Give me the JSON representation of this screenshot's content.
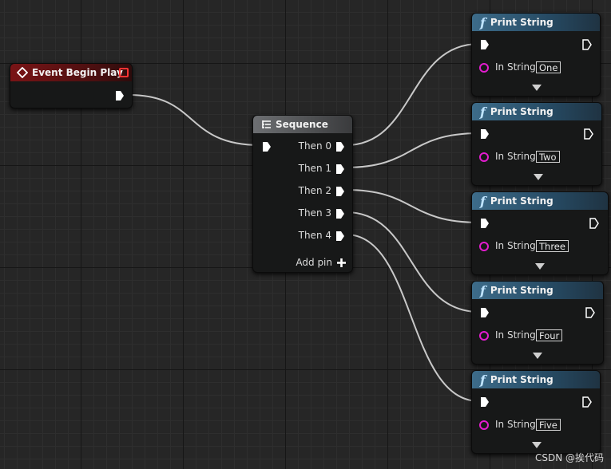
{
  "event_node": {
    "title": "Event Begin Play"
  },
  "sequence_node": {
    "title": "Sequence",
    "outputs": [
      "Then 0",
      "Then 1",
      "Then 2",
      "Then 3",
      "Then 4"
    ],
    "add_pin": "Add pin"
  },
  "print_nodes": [
    {
      "title": "Print String",
      "pin_label": "In String",
      "value": "One"
    },
    {
      "title": "Print String",
      "pin_label": "In String",
      "value": "Two"
    },
    {
      "title": "Print String",
      "pin_label": "In String",
      "value": "Three"
    },
    {
      "title": "Print String",
      "pin_label": "In String",
      "value": "Four"
    },
    {
      "title": "Print String",
      "pin_label": "In String",
      "value": "Five"
    }
  ],
  "watermark": "CSDN @挨代码",
  "colors": {
    "event_header": "#7a1416",
    "function_header": "#3d6c8a",
    "sequence_header": "#6d6f72",
    "string_pin": "#e31ccf",
    "wire": "#c8c8c8"
  },
  "icons": {
    "event": "event-diamond-icon",
    "function": "function-f-icon",
    "sequence": "sequence-icon",
    "exec": "exec-pin-icon",
    "string": "string-pin-icon",
    "expand": "expand-arrow-icon",
    "add": "plus-icon"
  }
}
